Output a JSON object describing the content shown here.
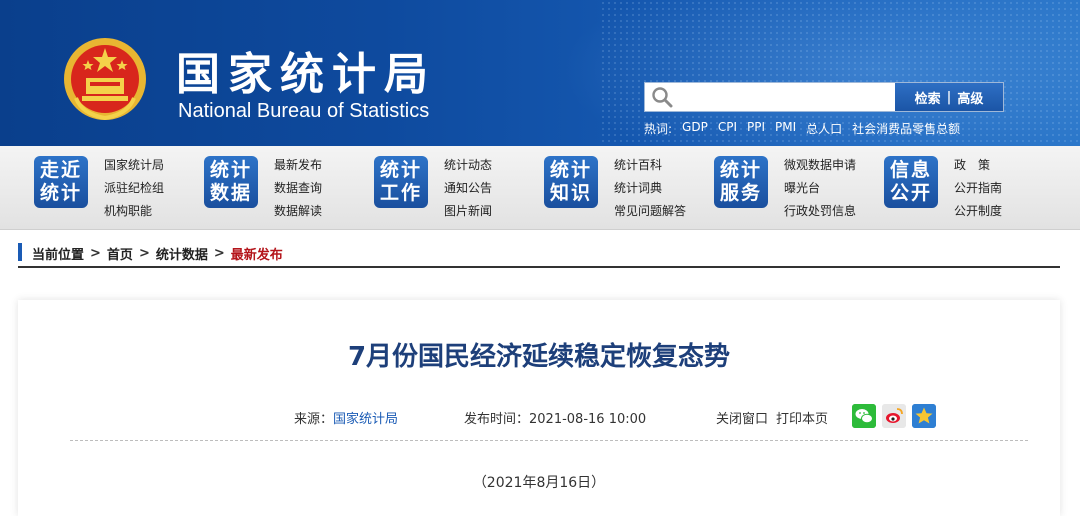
{
  "header": {
    "title_cn": "国家统计局",
    "title_en": "National Bureau of Statistics",
    "search": {
      "placeholder": "",
      "search_label": "检索",
      "advanced_label": "高级"
    },
    "hotwords": {
      "label": "热词:",
      "items": [
        "GDP",
        "CPI",
        "PPI",
        "PMI",
        "总人口",
        "社会消费品零售总额"
      ]
    }
  },
  "nav": [
    {
      "badge_line1": "走近",
      "badge_line2": "统计",
      "links": [
        "国家统计局",
        "派驻纪检组",
        "机构职能"
      ]
    },
    {
      "badge_line1": "统计",
      "badge_line2": "数据",
      "links": [
        "最新发布",
        "数据查询",
        "数据解读"
      ]
    },
    {
      "badge_line1": "统计",
      "badge_line2": "工作",
      "links": [
        "统计动态",
        "通知公告",
        "图片新闻"
      ]
    },
    {
      "badge_line1": "统计",
      "badge_line2": "知识",
      "links": [
        "统计百科",
        "统计词典",
        "常见问题解答"
      ]
    },
    {
      "badge_line1": "统计",
      "badge_line2": "服务",
      "links": [
        "微观数据申请",
        "曝光台",
        "行政处罚信息"
      ]
    },
    {
      "badge_line1": "信息",
      "badge_line2": "公开",
      "links": [
        "政　策",
        "公开指南",
        "公开制度"
      ]
    }
  ],
  "breadcrumb": {
    "label": "当前位置",
    "items": [
      "首页",
      "统计数据"
    ],
    "current": "最新发布"
  },
  "article": {
    "title": "7月份国民经济延续稳定恢复态势",
    "source_label": "来源：",
    "source_value": "国家统计局",
    "time_label": "发布时间：",
    "time_value": "2021-08-16 10:00",
    "close_label": "关闭窗口",
    "print_label": "打印本页",
    "date_line": "（2021年8月16日）"
  },
  "colors": {
    "header_blue": "#0e4a9e",
    "badge_blue": "#1a4f9e",
    "title_blue": "#1d3f7a",
    "breadcrumb_current": "#b4151b"
  }
}
